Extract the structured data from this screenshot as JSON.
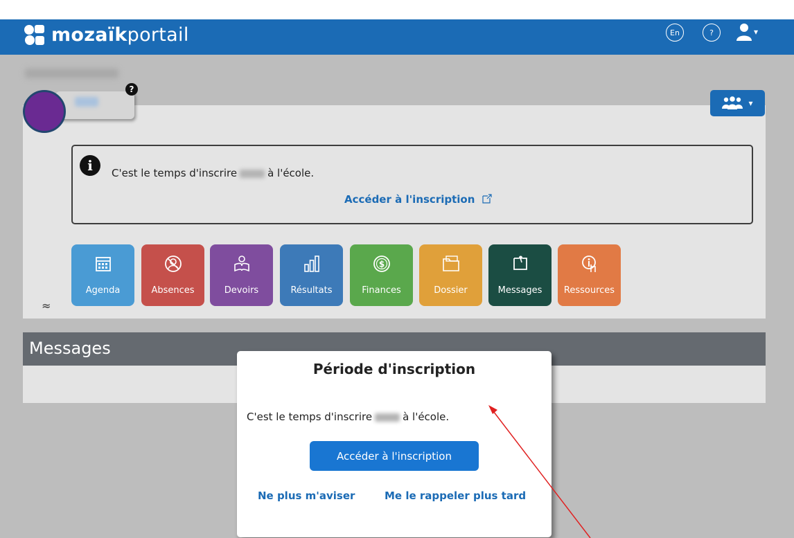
{
  "header": {
    "brand_bold": "mozaïk",
    "brand_light": "portail",
    "lang_label": "En",
    "help_label": "?",
    "user_menu_caret": "▾"
  },
  "child": {
    "help_badge": "?"
  },
  "group_menu_caret": "▾",
  "notice": {
    "text_before": "C'est le temps d'inscrire",
    "text_after": "à l'école.",
    "link_label": "Accéder à l'inscription"
  },
  "tiles": [
    {
      "label": "Agenda",
      "color": "#4a9bd4",
      "icon": "calendar-icon"
    },
    {
      "label": "Absences",
      "color": "#c5504b",
      "icon": "absence-icon"
    },
    {
      "label": "Devoirs",
      "color": "#7f4d9e",
      "icon": "homework-icon"
    },
    {
      "label": "Résultats",
      "color": "#3d7ab8",
      "icon": "results-icon"
    },
    {
      "label": "Finances",
      "color": "#5aa84c",
      "icon": "finances-icon"
    },
    {
      "label": "Dossier",
      "color": "#e0a03a",
      "icon": "folder-icon"
    },
    {
      "label": "Messages",
      "color": "#1b4d43",
      "icon": "messages-icon"
    },
    {
      "label": "Ressources",
      "color": "#e17a45",
      "icon": "resources-icon"
    }
  ],
  "collapse_glyph": "≈",
  "messages_section": {
    "title": "Messages"
  },
  "modal": {
    "title": "Période d'inscription",
    "text_before": "C'est le temps d'inscrire",
    "text_after": "à l'école.",
    "primary_button": "Accéder à l'inscription",
    "link_dismiss": "Ne plus m'aviser",
    "link_later": "Me le rappeler plus tard"
  },
  "colors": {
    "brand_blue": "#1b6bb5",
    "button_blue": "#1976d2",
    "annotation_arrow": "#e02020"
  }
}
